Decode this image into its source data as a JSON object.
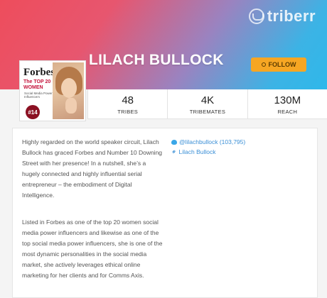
{
  "brand": {
    "name": "triberr",
    "icon": "triberr-logo-icon"
  },
  "profile": {
    "name": "LILACH BULLOCK",
    "follow_label": "FOLLOW",
    "avatar": {
      "magazine": "Forbes",
      "headline_line1": "The TOP 20",
      "headline_line2": "WOMEN",
      "subtitle": "Social Media Power Influencers",
      "rank": "#14"
    }
  },
  "stats": [
    {
      "value": "48",
      "label": "TRIBES"
    },
    {
      "value": "4K",
      "label": "TRIBEMATES"
    },
    {
      "value": "130M",
      "label": "REACH"
    }
  ],
  "bio": {
    "paragraph1": "Highly regarded on the world speaker circuit, Lilach Bullock has graced Forbes and Number 10 Downing Street with her presence! In a nutshell, she’s a hugely connected and highly influential serial entrepreneur – the embodiment of Digital Intelligence.",
    "paragraph2": "Listed in Forbes as one of the top 20 women social media power influencers and likewise as one of the top social media power influencers, she is one of the most dynamic personalities in the social media market, she actively leverages ethical online marketing for her clients and for Comms Axis."
  },
  "links": {
    "twitter": "@lilachbullock (103,795)",
    "website": "Lilach Bullock"
  },
  "colors": {
    "banner_start": "#ee4d5c",
    "banner_end": "#2fb8ea",
    "follow_button": "#f6a623",
    "link": "#3a8fd6",
    "rank_badge": "#8b1022"
  }
}
